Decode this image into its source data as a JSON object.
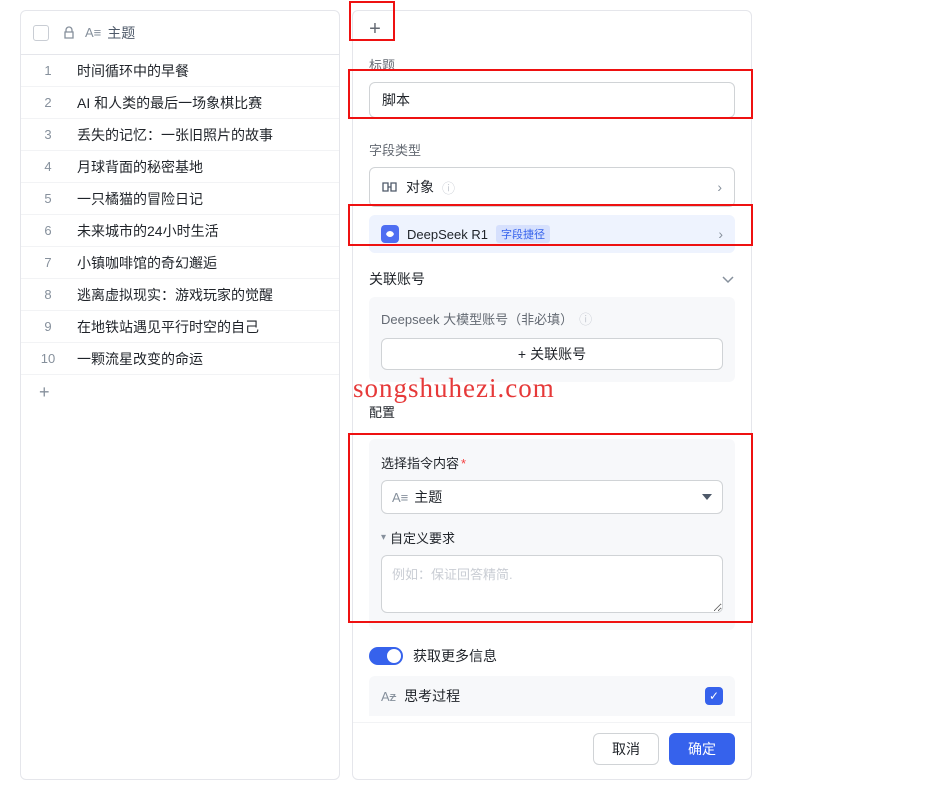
{
  "table": {
    "header_label": "主题",
    "rows": [
      "时间循环中的早餐",
      "AI 和人类的最后一场象棋比赛",
      "丢失的记忆：一张旧照片的故事",
      "月球背面的秘密基地",
      "一只橘猫的冒险日记",
      "未来城市的24小时生活",
      "小镇咖啡馆的奇幻邂逅",
      "逃离虚拟现实：游戏玩家的觉醒",
      "在地铁站遇见平行时空的自己",
      "一颗流星改变的命运"
    ]
  },
  "form": {
    "title_label": "标题",
    "title_value": "脚本",
    "field_type_label": "字段类型",
    "field_type_value": "对象",
    "deepseek_name": "DeepSeek R1",
    "deepseek_tag": "字段捷径",
    "account_section_label": "关联账号",
    "account_label": "Deepseek 大模型账号（非必填）",
    "link_account_btn": "关联账号",
    "config_label": "配置",
    "instruction_label": "选择指令内容",
    "instruction_value": "主题",
    "custom_label": "自定义要求",
    "custom_placeholder": "例如：保证回答精简.",
    "more_info_label": "获取更多信息",
    "process_label": "思考过程",
    "cancel": "取消",
    "confirm": "确定"
  },
  "watermark": "songshuhezi.com"
}
